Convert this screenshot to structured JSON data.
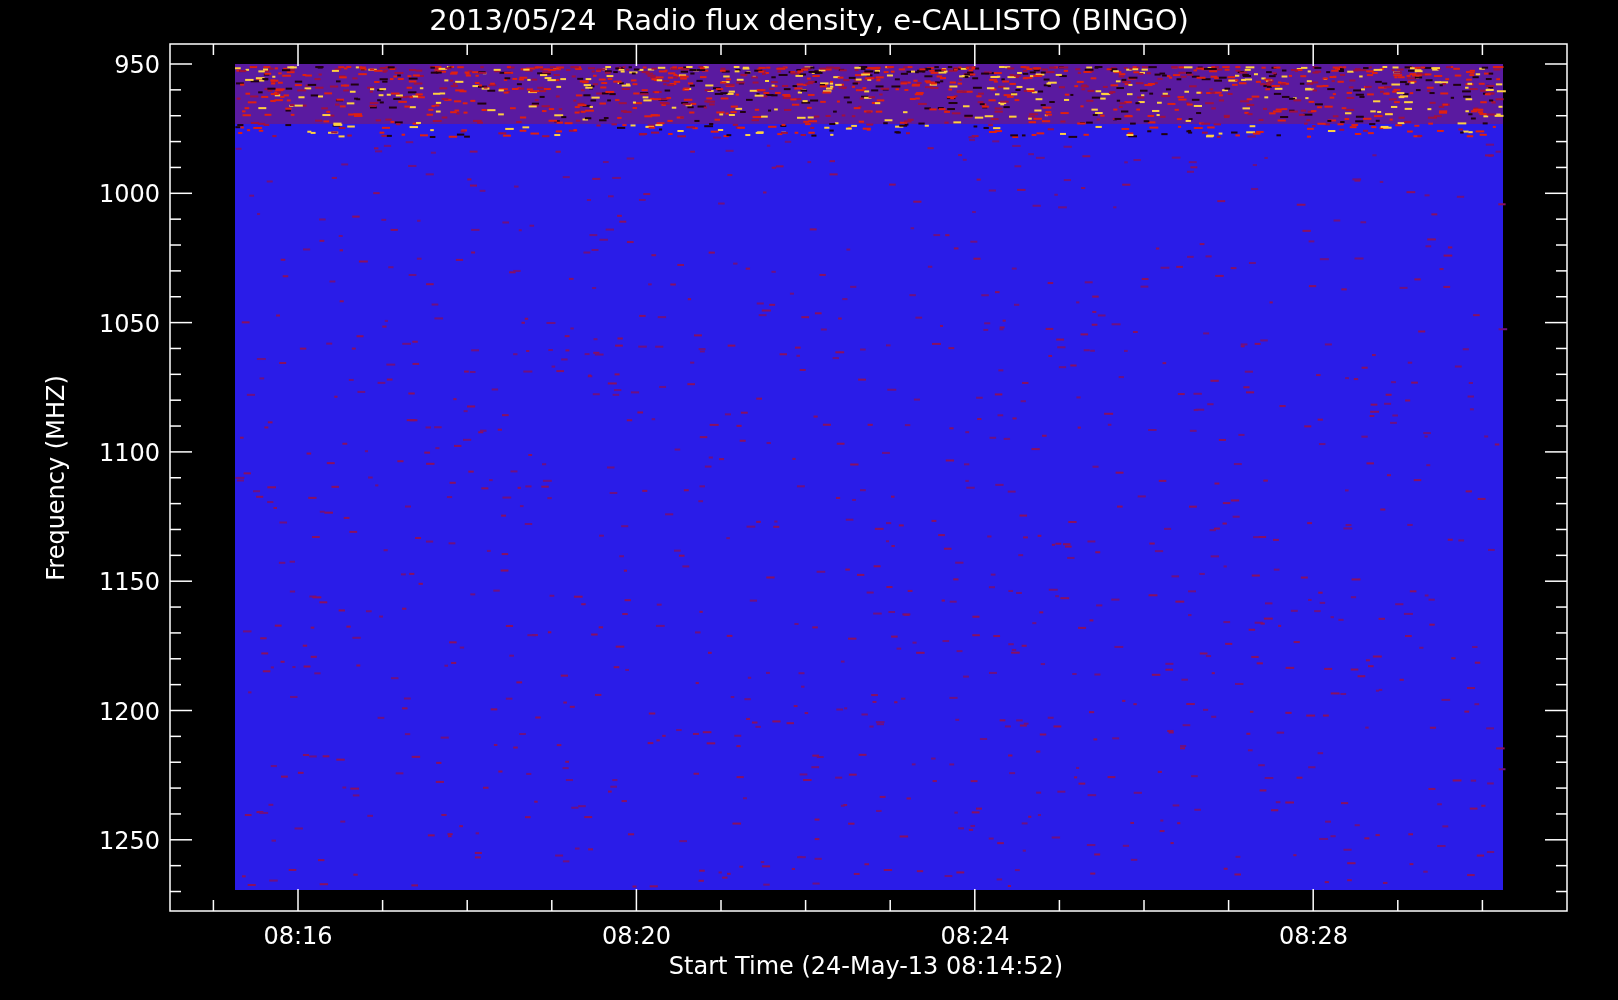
{
  "chart": {
    "title": "2013/05/24  Radio flux density, e-CALLISTO (BINGO)",
    "ylabel": "Frequency (MHZ)",
    "yticks": [
      "950",
      "1000",
      "1050",
      "1100",
      "1150",
      "1200",
      "1250"
    ],
    "xticks": [
      "08:16",
      "08:20",
      "08:24",
      "08:28"
    ],
    "xlabel": "Start Time (24-May-13 08:14:52)"
  }
}
